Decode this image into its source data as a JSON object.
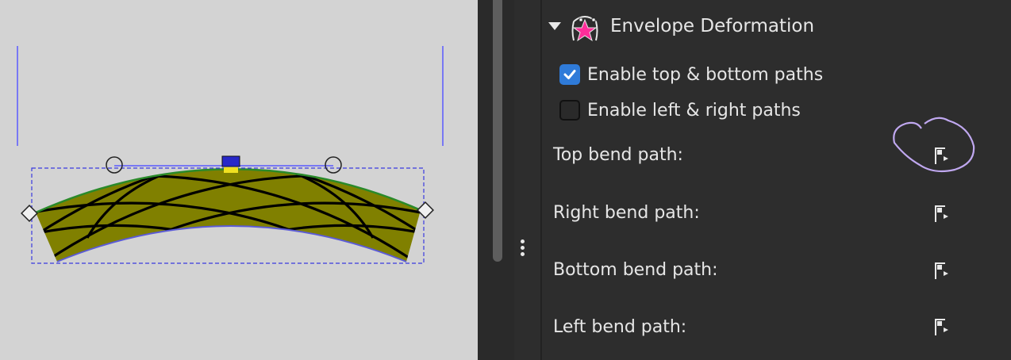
{
  "panel": {
    "effect_title": "Envelope Deformation",
    "effect_icon": "envelope-star-icon",
    "enable_top_bottom": {
      "label": "Enable top & bottom paths",
      "checked": true
    },
    "enable_left_right": {
      "label": "Enable left & right paths",
      "checked": false
    },
    "path_rows": [
      {
        "label": "Top bend path:",
        "button_icon": "edit-path-on-canvas-icon"
      },
      {
        "label": "Right bend path:",
        "button_icon": "edit-path-on-canvas-icon"
      },
      {
        "label": "Bottom bend path:",
        "button_icon": "edit-path-on-canvas-icon"
      },
      {
        "label": "Left bend path:",
        "button_icon": "edit-path-on-canvas-icon"
      }
    ]
  },
  "colors": {
    "canvas_bg": "#d3d3d3",
    "panel_bg": "#2d2d2d",
    "checkbox_accent": "#2f7bd9",
    "shape_fill": "#808000",
    "highlight_circle": "#c0a8f0",
    "guide_line": "#5a5aff"
  }
}
